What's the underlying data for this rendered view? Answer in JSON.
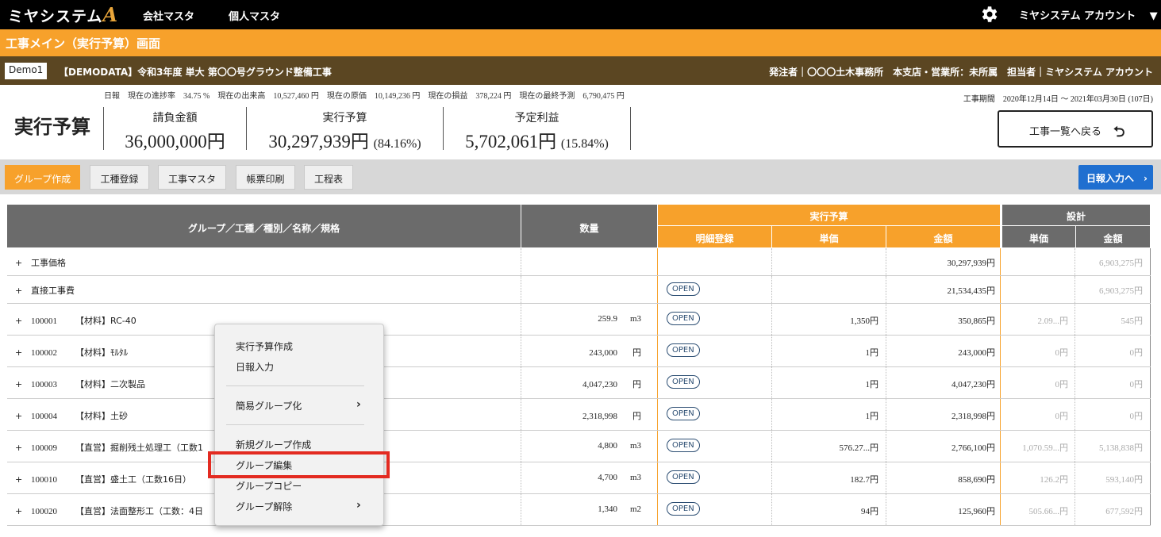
{
  "app": {
    "logo_text": "ミヤシステム",
    "logo_mark": "A",
    "nav": [
      "会社マスタ",
      "個人マスタ"
    ],
    "account": "ミヤシステム アカウント",
    "account_caret": "▼"
  },
  "screen_title": "工事メイン（実行予算）画面",
  "project": {
    "badge": "Demo1",
    "name": "【DEMODATA】令和3年度 単大 第〇〇号グラウンド整備工事",
    "right": "発注者｜〇〇〇土木事務所　本支店・営業所：未所属　担当者｜ミヤシステム アカウント"
  },
  "stats": [
    "日報",
    "現在の進捗率　34.75 %",
    "現在の出来高　10,527,460 円",
    "現在の原価　10,149,236 円",
    "現在の損益　378,224 円",
    "現在の最終予測　6,790,475 円"
  ],
  "period": "工事期間　2020年12月14日 〜 2021年03月30日 (107日)",
  "page_heading": "実行予算",
  "kpis": [
    {
      "label": "請負金額",
      "value": "36,000,000円",
      "sub": ""
    },
    {
      "label": "実行予算",
      "value": "30,297,939円",
      "sub": "(84.16%)"
    },
    {
      "label": "予定利益",
      "value": "5,702,061円",
      "sub": "(15.84%)"
    }
  ],
  "back_button": "工事一覧へ戻る",
  "back_arrow": "⮌",
  "toolbar": {
    "buttons": [
      "グループ作成",
      "工種登録",
      "工事マスタ",
      "帳票印刷",
      "工程表"
    ],
    "nippou": "日報入力へ　›"
  },
  "table": {
    "h_group": "グループ／工種／種別／名称／規格",
    "h_qty": "数量",
    "h_budget": "実行予算",
    "h_detail": "明細登録",
    "h_unit": "単価",
    "h_amount": "金額",
    "h_design": "設計",
    "h_dunit": "単価",
    "h_damount": "金額",
    "rows": [
      {
        "plus": "+",
        "code": "",
        "name": "工事価格",
        "qty": "",
        "unit": "",
        "open": "",
        "price": "",
        "amount": "30,297,939円",
        "d_price": "",
        "d_amount": "6,903,275円"
      },
      {
        "plus": "+",
        "code": "",
        "name": "直接工事費",
        "qty": "",
        "unit": "",
        "open": "OPEN",
        "price": "",
        "amount": "21,534,435円",
        "d_price": "",
        "d_amount": "6,903,275円"
      },
      {
        "plus": "+",
        "code": "100001",
        "name": "【材料】RC-40",
        "qty": "259.9",
        "unit": "m3",
        "open": "OPEN",
        "price": "1,350円",
        "amount": "350,865円",
        "d_price": "2.09...円",
        "d_amount": "545円"
      },
      {
        "plus": "+",
        "code": "100002",
        "name": "【材料】ﾓﾙﾀﾙ",
        "qty": "243,000",
        "unit": "円",
        "open": "OPEN",
        "price": "1円",
        "amount": "243,000円",
        "d_price": "0円",
        "d_amount": "0円"
      },
      {
        "plus": "+",
        "code": "100003",
        "name": "【材料】二次製品",
        "qty": "4,047,230",
        "unit": "円",
        "open": "OPEN",
        "price": "1円",
        "amount": "4,047,230円",
        "d_price": "0円",
        "d_amount": "0円"
      },
      {
        "plus": "+",
        "code": "100004",
        "name": "【材料】土砂",
        "qty": "2,318,998",
        "unit": "円",
        "open": "OPEN",
        "price": "1円",
        "amount": "2,318,998円",
        "d_price": "0円",
        "d_amount": "0円"
      },
      {
        "plus": "+",
        "code": "100009",
        "name": "【直営】掘削残土処理工（工数1",
        "qty": "4,800",
        "unit": "m3",
        "open": "OPEN",
        "price": "576.27...円",
        "amount": "2,766,100円",
        "d_price": "1,070.59...円",
        "d_amount": "5,138,838円"
      },
      {
        "plus": "+",
        "code": "100010",
        "name": "【直営】盛土工（工数16日）",
        "qty": "4,700",
        "unit": "m3",
        "open": "OPEN",
        "price": "182.7円",
        "amount": "858,690円",
        "d_price": "126.2円",
        "d_amount": "593,140円"
      },
      {
        "plus": "+",
        "code": "100020",
        "name": "【直営】法面整形工（工数：4日",
        "qty": "1,340",
        "unit": "m2",
        "open": "OPEN",
        "price": "94円",
        "amount": "125,960円",
        "d_price": "505.66...円",
        "d_amount": "677,592円"
      }
    ]
  },
  "context_menu": {
    "items": [
      "実行予算作成",
      "日報入力",
      "簡易グループ化",
      "新規グループ作成",
      "グループ編集",
      "グループコピー",
      "グループ解除"
    ],
    "chevron": "›"
  }
}
